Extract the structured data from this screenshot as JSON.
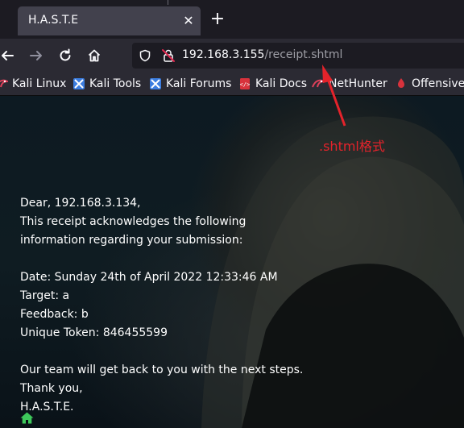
{
  "browser": {
    "tab": {
      "title": "H.A.S.T.E",
      "close_label": "✕"
    },
    "new_tab_label": "+",
    "url": {
      "host": "192.168.3.155",
      "path": "/receipt.shtml"
    }
  },
  "bookmarks": [
    {
      "label": "Kali Linux",
      "icon": "kali-dragon-icon"
    },
    {
      "label": "Kali Tools",
      "icon": "kali-tools-icon"
    },
    {
      "label": "Kali Forums",
      "icon": "kali-forums-icon"
    },
    {
      "label": "Kali Docs",
      "icon": "kali-docs-icon"
    },
    {
      "label": "NetHunter",
      "icon": "nethunter-icon"
    },
    {
      "label": "Offensive Security",
      "icon": "offsec-icon"
    }
  ],
  "receipt": {
    "greeting": "Dear, 192.168.3.134,",
    "intro_1": "This receipt acknowledges the following",
    "intro_2": "information regarding your submission:",
    "date": "Date: Sunday 24th of April 2022 12:33:46 AM",
    "target": "Target: a",
    "feedback": "Feedback: b",
    "token": "Unique Token: 846455599",
    "followup": "Our team will get back to you with the next steps.",
    "thanks": "Thank you,",
    "signature": "H.A.S.T.E."
  },
  "annotation": {
    "text": ".shtml格式",
    "color": "#e4232b"
  },
  "colors": {
    "tabbar": "#1c1b22",
    "toolbar": "#2b2a33",
    "tab_active": "#42414d",
    "home_icon": "#3ec95b"
  }
}
